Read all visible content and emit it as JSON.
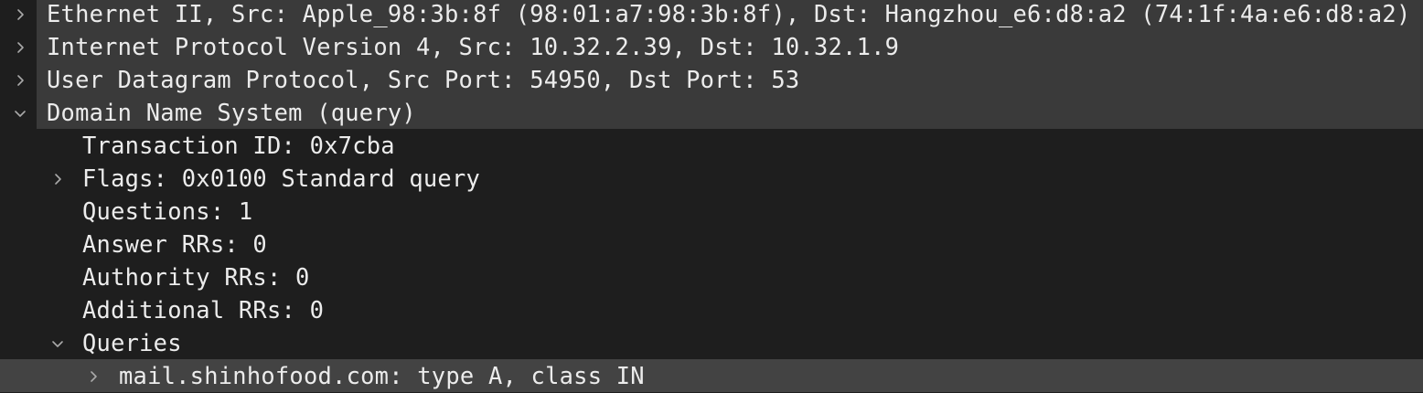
{
  "tree": {
    "ethernet": {
      "label": "Ethernet II, Src: Apple_98:3b:8f (98:01:a7:98:3b:8f), Dst: Hangzhou_e6:d8:a2 (74:1f:4a:e6:d8:a2)",
      "expanded": false
    },
    "ipv4": {
      "label": "Internet Protocol Version 4, Src: 10.32.2.39, Dst: 10.32.1.9",
      "expanded": false
    },
    "udp": {
      "label": "User Datagram Protocol, Src Port: 54950, Dst Port: 53",
      "expanded": false
    },
    "dns": {
      "label": "Domain Name System (query)",
      "expanded": true,
      "transaction_id": "Transaction ID: 0x7cba",
      "flags": {
        "label": "Flags: 0x0100 Standard query",
        "expanded": false
      },
      "questions": "Questions: 1",
      "answer_rrs": "Answer RRs: 0",
      "authority_rrs": "Authority RRs: 0",
      "additional_rrs": "Additional RRs: 0",
      "queries": {
        "label": "Queries",
        "expanded": true,
        "items": [
          {
            "label": "mail.shinhofood.com: type A, class IN",
            "expanded": false,
            "selected": true
          }
        ]
      }
    }
  },
  "icons": {
    "collapsed": "chevron-right-icon",
    "expanded": "chevron-down-icon"
  },
  "colors": {
    "background": "#1e1e1e",
    "top_level_row": "#3a3a3a",
    "selected_row": "#434343",
    "text": "#ececec",
    "chevron": "#a9a9a9"
  }
}
